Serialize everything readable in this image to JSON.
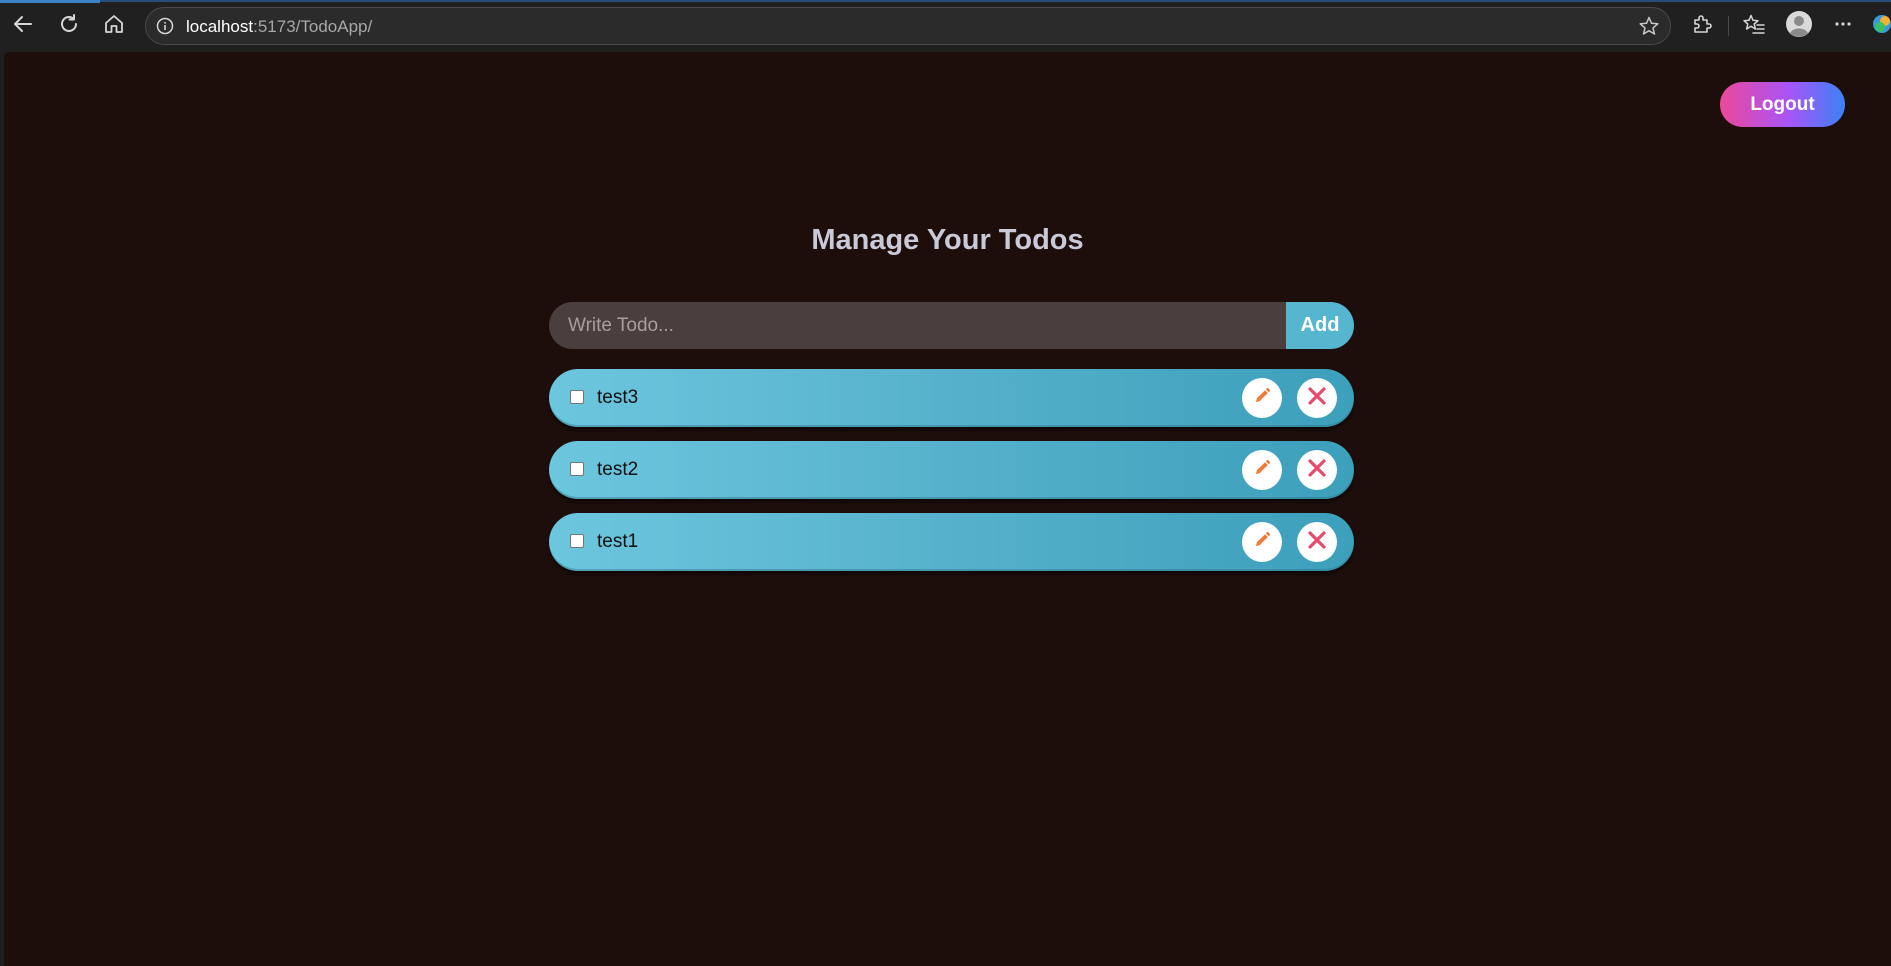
{
  "browser": {
    "url_host": "localhost",
    "url_rest": ":5173/TodoApp/",
    "accent_color": "#3b82c4",
    "icons": [
      "back-arrow-icon",
      "refresh-icon",
      "home-icon",
      "info-icon",
      "star-icon",
      "extensions-icon",
      "favorites-icon",
      "profile-icon",
      "more-icon"
    ]
  },
  "app": {
    "logout_label": "Logout",
    "title": "Manage Your Todos",
    "input_placeholder": "Write Todo...",
    "input_value": "",
    "add_label": "Add",
    "colors": {
      "background": "#1d0d0b",
      "todo_item": "#58b3cd",
      "input_bg": "#4b3e3e",
      "edit_icon": "#f07a3a",
      "delete_icon": "#e94a6b",
      "logout_gradient": [
        "#ec4899",
        "#a855f7",
        "#3b82f6"
      ]
    },
    "todos": [
      {
        "text": "test3",
        "completed": false
      },
      {
        "text": "test2",
        "completed": false
      },
      {
        "text": "test1",
        "completed": false
      }
    ]
  }
}
